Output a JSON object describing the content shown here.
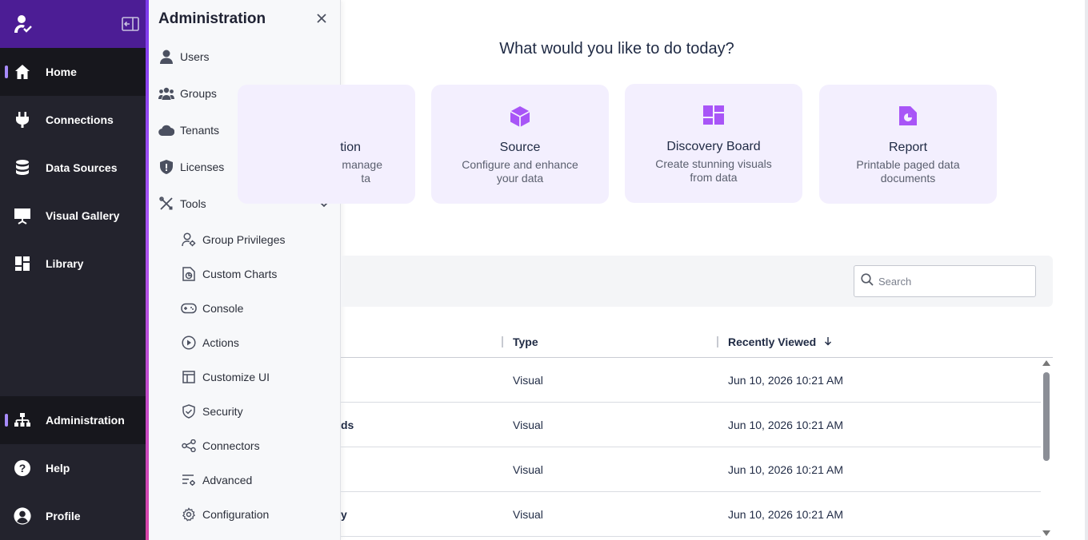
{
  "nav": {
    "items": [
      {
        "label": "Home",
        "icon": "home-icon",
        "active": true
      },
      {
        "label": "Connections",
        "icon": "plug-icon"
      },
      {
        "label": "Data Sources",
        "icon": "database-icon"
      },
      {
        "label": "Visual Gallery",
        "icon": "presentation-icon"
      },
      {
        "label": "Library",
        "icon": "grid-icon"
      }
    ],
    "bottom": [
      {
        "label": "Administration",
        "icon": "org-chart-icon",
        "active": true
      },
      {
        "label": "Help",
        "icon": "question-icon"
      },
      {
        "label": "Profile",
        "icon": "user-circle-icon"
      }
    ]
  },
  "admin_panel": {
    "title": "Administration",
    "close_icon": "close-icon",
    "items": [
      "Users",
      "Groups",
      "Tenants",
      "Licenses",
      "Tools"
    ],
    "tools_sub": [
      "Group Privileges",
      "Custom Charts",
      "Console",
      "Actions",
      "Customize UI",
      "Security",
      "Connectors",
      "Advanced",
      "Configuration"
    ]
  },
  "main": {
    "heading": "What would you like to do today?",
    "cards": [
      {
        "title": "tion",
        "desc": "manage ta",
        "desc_line1": "manage",
        "desc_line2": "ta"
      },
      {
        "title": "Source",
        "desc_line1": "Configure and enhance",
        "desc_line2": "your data",
        "icon": "cube-icon"
      },
      {
        "title": "Discovery Board",
        "desc_line1": "Create stunning visuals",
        "desc_line2": "from data",
        "icon": "dashboard-icon"
      },
      {
        "title": "Report",
        "desc_line1": "Printable paged data",
        "desc_line2": "documents",
        "icon": "report-icon"
      }
    ],
    "search_placeholder": "Search",
    "table": {
      "columns": [
        "Type",
        "Recently Viewed"
      ],
      "sort_icon": "arrow-down-icon",
      "rows": [
        {
          "name": "",
          "type": "Visual",
          "date": "Jun 10, 2026 10:21 AM"
        },
        {
          "name": "ds",
          "type": "Visual",
          "date": "Jun 10, 2026 10:21 AM"
        },
        {
          "name": "",
          "type": "Visual",
          "date": "Jun 10, 2026 10:21 AM"
        },
        {
          "name": "y",
          "type": "Visual",
          "date": "Jun 10, 2026 10:21 AM"
        }
      ]
    }
  },
  "colors": {
    "nav_bg": "#23232d",
    "nav_top": "#4c1d95",
    "accent": "#a78bfa",
    "card_bg": "#f3effe",
    "card_icon": "#a855f7"
  }
}
